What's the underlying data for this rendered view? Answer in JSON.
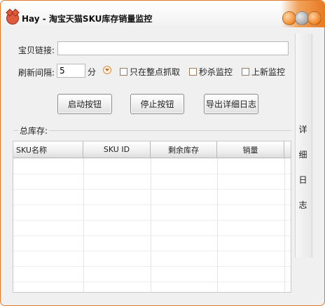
{
  "window": {
    "title": "Hay - 淘宝天猫SKU库存销量监控"
  },
  "form": {
    "link_label": "宝贝链接:",
    "link_value": "",
    "interval_label": "刷新间隔:",
    "interval_value": "5",
    "interval_unit": "分",
    "checkbox_whole_point": "只在整点抓取",
    "checkbox_flash_sale": "秒杀监控",
    "checkbox_new_listing": "上新监控"
  },
  "buttons": {
    "start": "启动按钮",
    "stop": "停止按钮",
    "export": "导出详细日志"
  },
  "stock": {
    "label": "总库存:"
  },
  "table": {
    "columns": [
      "SKU名称",
      "SKU ID",
      "剩余库存",
      "销量"
    ]
  },
  "side_panel": {
    "chars": [
      "详",
      "细",
      "日",
      "志"
    ]
  },
  "colors": {
    "accent_orange": "#e77a22",
    "min_button": "#f08a2c",
    "max_button": "#a9a9a9",
    "close_button": "#f0801e"
  }
}
